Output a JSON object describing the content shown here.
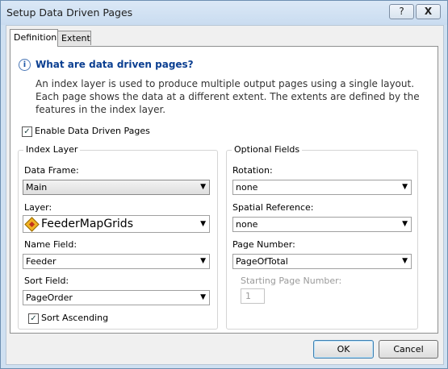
{
  "window": {
    "title": "Setup Data Driven Pages",
    "help_button": "?",
    "close_button": "X"
  },
  "tabs": [
    {
      "label": "Definition",
      "active": true
    },
    {
      "label": "Extent",
      "active": false
    }
  ],
  "info": {
    "heading": "What are data driven pages?",
    "description": "An index layer is used to produce multiple output pages using a single layout. Each page shows the data at a different extent.  The extents are defined by the features in the index layer.",
    "icon": "info-icon"
  },
  "enable_checkbox": {
    "label": "Enable Data Driven Pages",
    "checked": true
  },
  "index_layer": {
    "title": "Index Layer",
    "data_frame": {
      "label": "Data Frame:",
      "value": "Main"
    },
    "layer": {
      "label": "Layer:",
      "value": "FeederMapGrids",
      "icon": "polygon-layer-icon"
    },
    "name_field": {
      "label": "Name Field:",
      "value": "Feeder"
    },
    "sort_field": {
      "label": "Sort Field:",
      "value": "PageOrder"
    },
    "sort_ascending": {
      "label": "Sort Ascending",
      "checked": true
    }
  },
  "optional_fields": {
    "title": "Optional Fields",
    "rotation": {
      "label": "Rotation:",
      "value": "none"
    },
    "spatial_reference": {
      "label": "Spatial Reference:",
      "value": "none"
    },
    "page_number": {
      "label": "Page Number:",
      "value": "PageOfTotal"
    },
    "starting_page_number": {
      "label": "Starting Page Number:",
      "value": "1",
      "enabled": false
    }
  },
  "buttons": {
    "ok": "OK",
    "cancel": "Cancel"
  }
}
